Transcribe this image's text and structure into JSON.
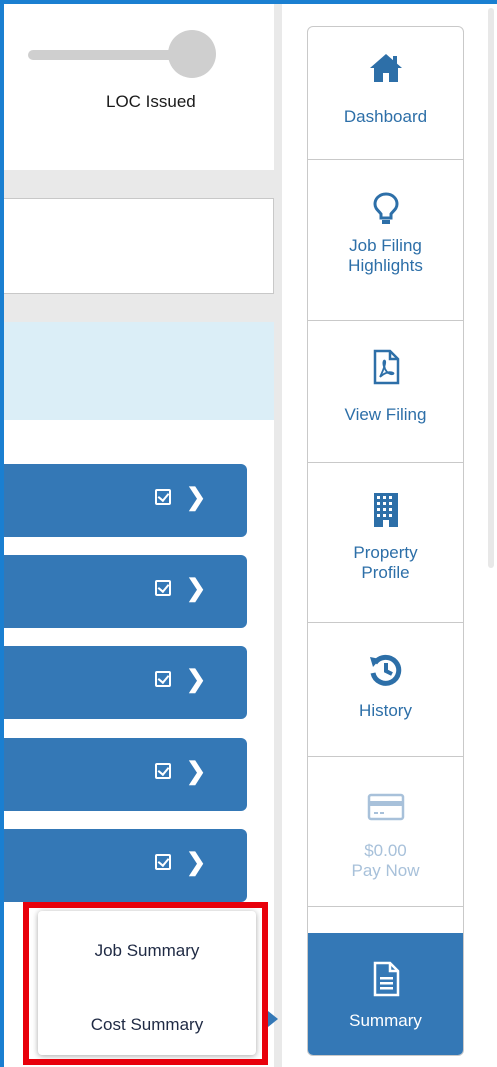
{
  "status": {
    "progress_label": "LOC Issued"
  },
  "section_bars": [
    {
      "checked": true
    },
    {
      "checked": true
    },
    {
      "checked": true
    },
    {
      "checked": true
    },
    {
      "checked": true
    }
  ],
  "summary_popup": {
    "items": [
      {
        "label": "Job Summary"
      },
      {
        "label": "Cost Summary"
      }
    ]
  },
  "side_nav": {
    "items": [
      {
        "label": "Dashboard",
        "icon": "home-icon"
      },
      {
        "label_line1": "Job Filing",
        "label_line2": "Highlights",
        "icon": "lightbulb-icon"
      },
      {
        "label": "View Filing",
        "icon": "pdf-file-icon"
      },
      {
        "label_line1": "Property",
        "label_line2": "Profile",
        "icon": "building-icon"
      },
      {
        "label": "History",
        "icon": "history-icon"
      },
      {
        "amount": "$0.00",
        "label": "Pay Now",
        "icon": "credit-card-icon",
        "disabled": true
      },
      {
        "label": "Summary",
        "icon": "document-icon",
        "active": true
      }
    ]
  },
  "colors": {
    "accent": "#3478b6",
    "nav_text": "#2d6fa8",
    "disabled_text": "#a8c1da",
    "highlight_border": "#e8000b",
    "info_band": "#dbeef7"
  }
}
